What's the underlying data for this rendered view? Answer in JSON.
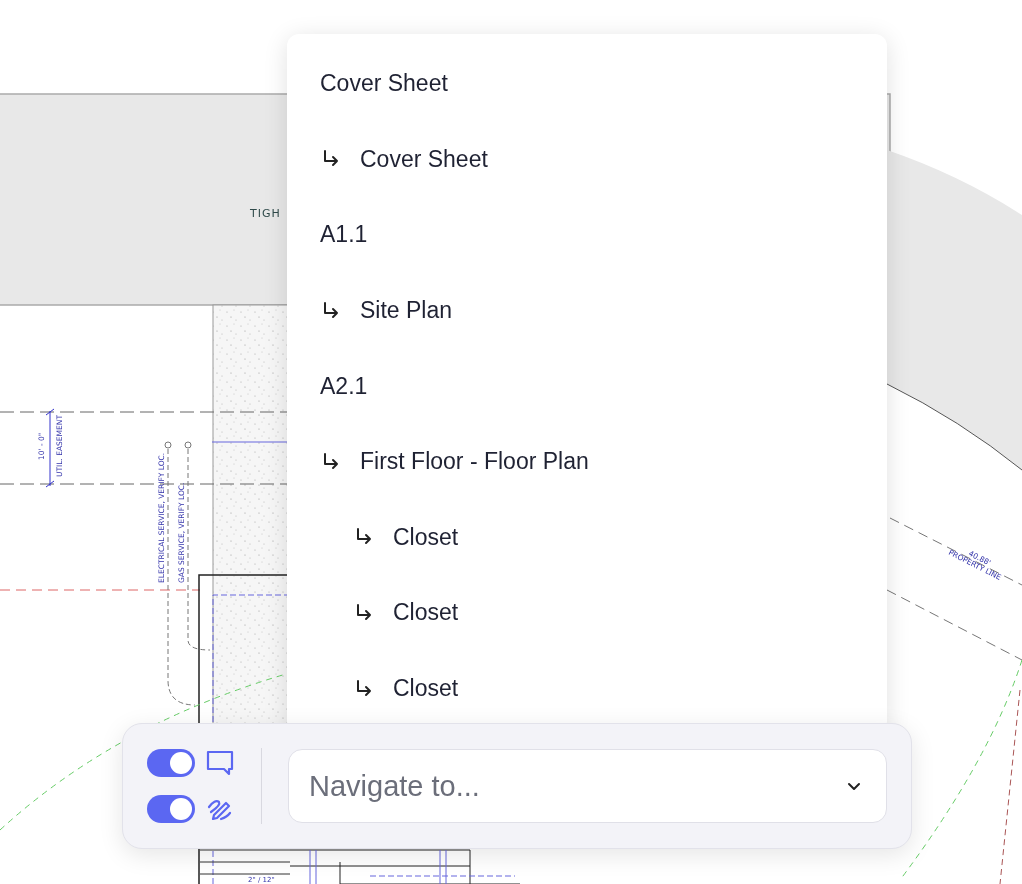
{
  "plan": {
    "title_fragment": "TIGH",
    "easement_dimension": "10' - 0\"",
    "easement_label": "UTIL. EASEMENT",
    "electrical_note": "ELECTRICAL SERVICE, VERIFY LOC.",
    "gas_note": "GAS SERVICE, VERIFY LOC.",
    "property_length": "40.88'",
    "property_label": "PROPERTY LINE",
    "stair_dimension": "2\" / 12\""
  },
  "navigator": {
    "placeholder": "Navigate to...",
    "expanded": true,
    "items": [
      {
        "label": "Cover Sheet",
        "children": [
          {
            "label": "Cover Sheet"
          }
        ]
      },
      {
        "label": "A1.1",
        "children": [
          {
            "label": "Site Plan"
          }
        ]
      },
      {
        "label": "A2.1",
        "children": [
          {
            "label": "First Floor - Floor Plan",
            "children": [
              {
                "label": "Closet"
              },
              {
                "label": "Closet"
              },
              {
                "label": "Closet"
              }
            ]
          }
        ]
      }
    ]
  },
  "toggles": [
    {
      "kind": "comments",
      "on": true
    },
    {
      "kind": "markup",
      "on": true
    }
  ]
}
